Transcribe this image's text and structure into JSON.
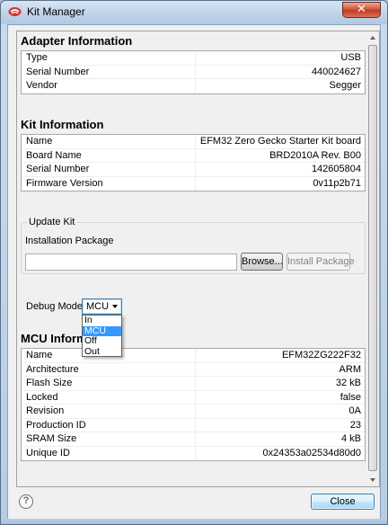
{
  "window": {
    "title": "Kit Manager",
    "close_glyph": "✕",
    "accent": "#3399ff"
  },
  "adapter": {
    "heading": "Adapter Information",
    "rows": [
      {
        "k": "Type",
        "v": "USB"
      },
      {
        "k": "Serial Number",
        "v": "440024627"
      },
      {
        "k": "Vendor",
        "v": "Segger"
      }
    ]
  },
  "kit": {
    "heading": "Kit Information",
    "rows": [
      {
        "k": "Name",
        "v": "EFM32 Zero Gecko Starter Kit board"
      },
      {
        "k": "Board Name",
        "v": "BRD2010A Rev. B00"
      },
      {
        "k": "Serial Number",
        "v": "142605804"
      },
      {
        "k": "Firmware Version",
        "v": "0v11p2b71"
      }
    ]
  },
  "update": {
    "group_label": "Update Kit",
    "package_label": "Installation Package",
    "package_value": "",
    "browse_label": "Browse...",
    "install_label": "Install Package"
  },
  "debug": {
    "label": "Debug Mode:",
    "selected": "MCU",
    "options": [
      "In",
      "MCU",
      "Off",
      "Out"
    ]
  },
  "mcu": {
    "heading": "MCU Inform",
    "rows": [
      {
        "k": "Name",
        "v": "EFM32ZG222F32"
      },
      {
        "k": "Architecture",
        "v": "ARM"
      },
      {
        "k": "Flash Size",
        "v": "32 kB"
      },
      {
        "k": "Locked",
        "v": "false"
      },
      {
        "k": "Revision",
        "v": "0A"
      },
      {
        "k": "Production ID",
        "v": "23"
      },
      {
        "k": "SRAM Size",
        "v": "4 kB"
      },
      {
        "k": "Unique ID",
        "v": "0x24353a02534d80d0"
      }
    ]
  },
  "footer": {
    "help_glyph": "?",
    "close_label": "Close"
  }
}
